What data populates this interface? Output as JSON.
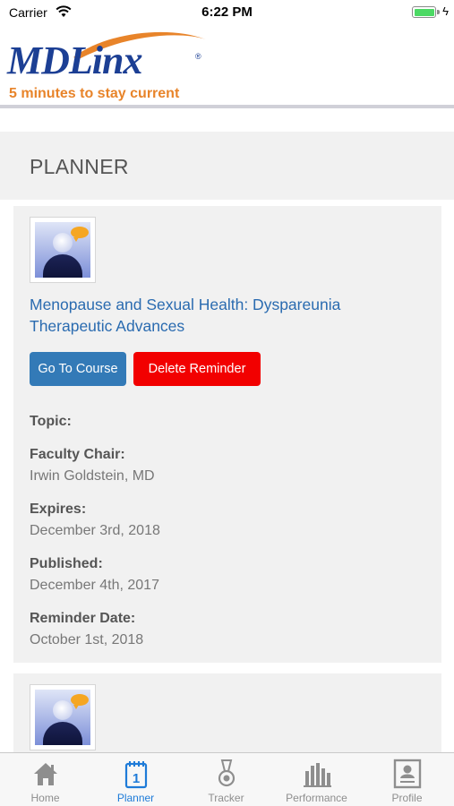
{
  "status_bar": {
    "carrier": "Carrier",
    "time": "6:22 PM",
    "battery_color": "#4cd964"
  },
  "header": {
    "logo_text": "MDLinx",
    "logo_registered": "®",
    "tagline": "5 minutes to stay current",
    "brand_blue": "#1c3f94",
    "brand_orange": "#e8842a"
  },
  "page": {
    "title": "PLANNER"
  },
  "cards": [
    {
      "icon": "presenter-thumbnail",
      "title": "Menopause and Sexual Health: Dyspareunia Therapeutic Advances",
      "go_to_course_label": "Go To Course",
      "delete_reminder_label": "Delete Reminder",
      "topic_label": "Topic:",
      "topic_value": "",
      "faculty_chair_label": "Faculty Chair:",
      "faculty_chair_value": "Irwin Goldstein, MD",
      "expires_label": "Expires:",
      "expires_value": "December 3rd, 2018",
      "published_label": "Published:",
      "published_value": "December 4th, 2017",
      "reminder_date_label": "Reminder Date:",
      "reminder_date_value": "October 1st, 2018"
    },
    {
      "icon": "presenter-thumbnail"
    }
  ],
  "tab_bar": {
    "tabs": [
      {
        "label": "Home",
        "icon": "home-icon",
        "active": false
      },
      {
        "label": "Planner",
        "icon": "planner-icon",
        "active": true
      },
      {
        "label": "Tracker",
        "icon": "tracker-medal-icon",
        "active": false
      },
      {
        "label": "Performance",
        "icon": "bar-chart-icon",
        "active": false
      },
      {
        "label": "Profile",
        "icon": "profile-icon",
        "active": false
      }
    ],
    "active_color": "#1e7bd8",
    "inactive_color": "#8e8e8e"
  }
}
